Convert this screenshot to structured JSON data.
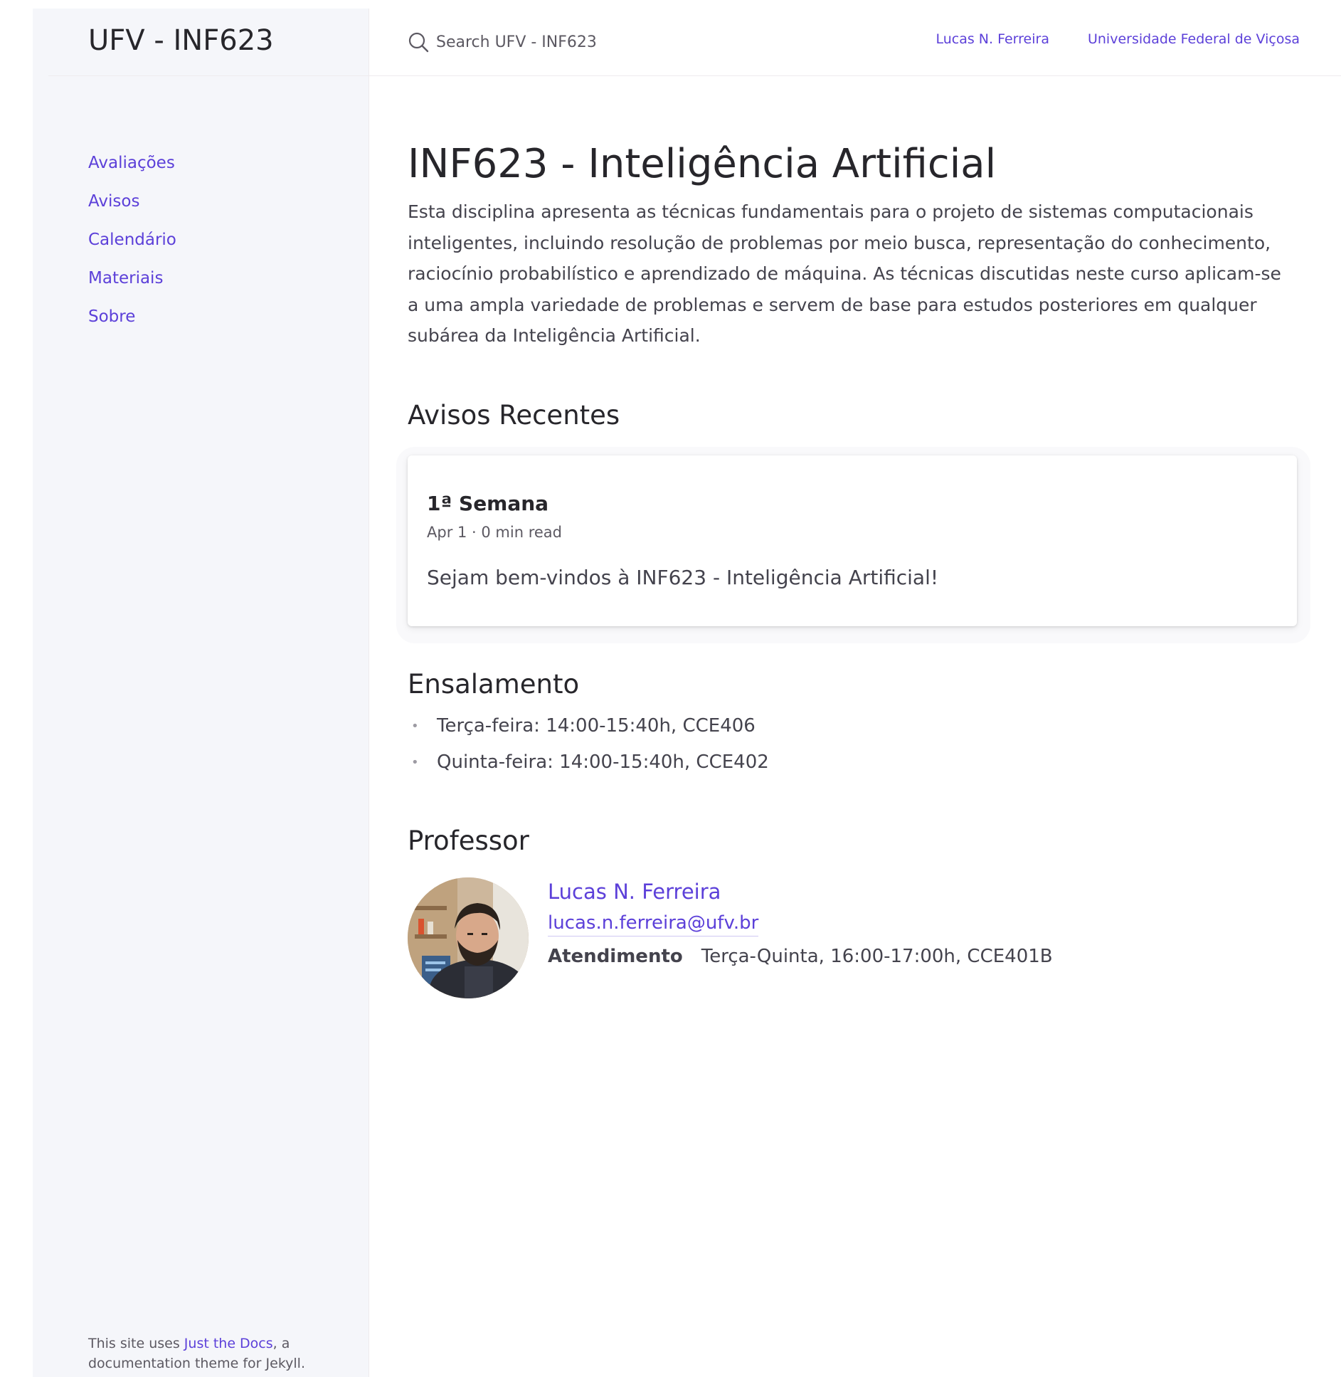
{
  "site": {
    "title": "UFV - INF623"
  },
  "sidebar": {
    "nav": [
      {
        "label": "Avaliações"
      },
      {
        "label": "Avisos"
      },
      {
        "label": "Calendário"
      },
      {
        "label": "Materiais"
      },
      {
        "label": "Sobre"
      }
    ],
    "footer": {
      "prefix": "This site uses ",
      "link": "Just the Docs",
      "suffix": ", a documentation theme for Jekyll."
    }
  },
  "header": {
    "search_placeholder": "Search UFV - INF623",
    "aux_links": [
      {
        "label": "Lucas N. Ferreira"
      },
      {
        "label": "Universidade Federal de Viçosa"
      }
    ]
  },
  "main": {
    "title": "INF623 - Inteligência Artificial",
    "intro": "Esta disciplina apresenta as técnicas fundamentais para o projeto de sistemas computacionais inteligentes, incluindo resolução de problemas por meio busca, representação do conhecimento, raciocínio probabilístico e aprendizado de máquina. As técnicas discutidas neste curso aplicam-se a uma ampla variedade de problemas e servem de base para estudos posteriores em qualquer subárea da Inteligência Artificial.",
    "announcements": {
      "heading": "Avisos Recentes",
      "items": [
        {
          "title": "1ª Semana",
          "meta": "Apr 1 · 0 min read",
          "body": "Sejam bem-vindos à INF623 - Inteligência Artificial!"
        }
      ]
    },
    "schedule": {
      "heading": "Ensalamento",
      "items": [
        "Terça-feira: 14:00-15:40h, CCE406",
        "Quinta-feira: 14:00-15:40h, CCE402"
      ]
    },
    "professor": {
      "heading": "Professor",
      "name": "Lucas N. Ferreira",
      "email": "lucas.n.ferreira@ufv.br",
      "hours_label": "Atendimento",
      "hours_value": "Terça-Quinta, 16:00-17:00h, CCE401B"
    }
  },
  "colors": {
    "link": "#5c40d9",
    "sidebar_bg": "#f5f6fa",
    "text": "#27262b"
  }
}
